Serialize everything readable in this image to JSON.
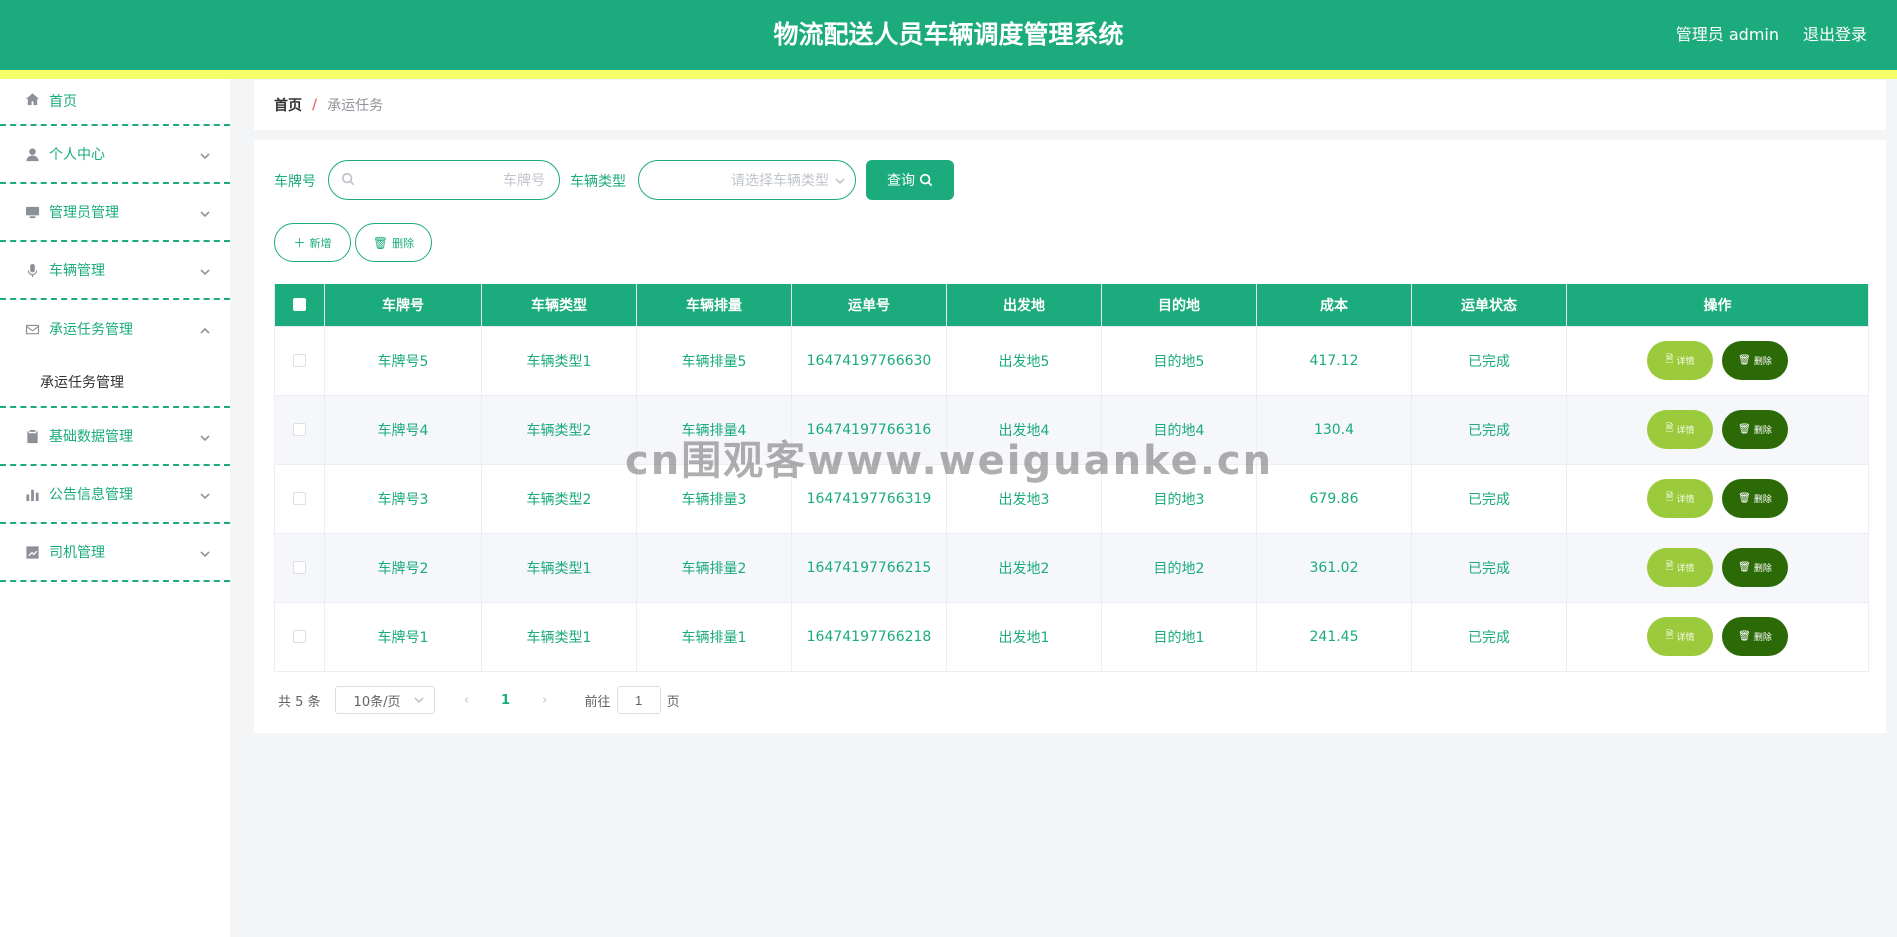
{
  "header": {
    "title": "物流配送人员车辆调度管理系统",
    "user": "管理员 admin",
    "logout": "退出登录"
  },
  "sidebar": {
    "items": [
      {
        "label": "首页",
        "icon": "home-icon"
      },
      {
        "label": "个人中心",
        "icon": "user-icon"
      },
      {
        "label": "管理员管理",
        "icon": "monitor-icon"
      },
      {
        "label": "车辆管理",
        "icon": "microphone-icon"
      },
      {
        "label": "承运任务管理",
        "icon": "mail-icon",
        "submenu": [
          "承运任务管理"
        ]
      },
      {
        "label": "基础数据管理",
        "icon": "clipboard-icon"
      },
      {
        "label": "公告信息管理",
        "icon": "bar-chart-icon"
      },
      {
        "label": "司机管理",
        "icon": "trend-chart-icon"
      }
    ]
  },
  "breadcrumb": {
    "home": "首页",
    "separator": "/",
    "current": "承运任务"
  },
  "search": {
    "plate_label": "车牌号",
    "plate_placeholder": "车牌号",
    "type_label": "车辆类型",
    "type_placeholder": "请选择车辆类型",
    "query_button": "查询"
  },
  "actions": {
    "add": "新增",
    "delete": "删除"
  },
  "table": {
    "columns": [
      "车牌号",
      "车辆类型",
      "车辆排量",
      "运单号",
      "出发地",
      "目的地",
      "成本",
      "运单状态",
      "操作"
    ],
    "rows": [
      {
        "plate": "车牌号5",
        "type": "车辆类型1",
        "displacement": "车辆排量5",
        "waybill": "16474197766630",
        "origin": "出发地5",
        "destination": "目的地5",
        "cost": "417.12",
        "status": "已完成"
      },
      {
        "plate": "车牌号4",
        "type": "车辆类型2",
        "displacement": "车辆排量4",
        "waybill": "16474197766316",
        "origin": "出发地4",
        "destination": "目的地4",
        "cost": "130.4",
        "status": "已完成"
      },
      {
        "plate": "车牌号3",
        "type": "车辆类型2",
        "displacement": "车辆排量3",
        "waybill": "16474197766319",
        "origin": "出发地3",
        "destination": "目的地3",
        "cost": "679.86",
        "status": "已完成"
      },
      {
        "plate": "车牌号2",
        "type": "车辆类型1",
        "displacement": "车辆排量2",
        "waybill": "16474197766215",
        "origin": "出发地2",
        "destination": "目的地2",
        "cost": "361.02",
        "status": "已完成"
      },
      {
        "plate": "车牌号1",
        "type": "车辆类型1",
        "displacement": "车辆排量1",
        "waybill": "16474197766218",
        "origin": "出发地1",
        "destination": "目的地1",
        "cost": "241.45",
        "status": "已完成"
      }
    ],
    "row_actions": {
      "detail": "详情",
      "delete": "删除"
    }
  },
  "pagination": {
    "total": "共 5 条",
    "page_size": "10条/页",
    "current_page": "1",
    "goto_prefix": "前往",
    "goto_value": "1",
    "goto_suffix": "页"
  },
  "watermark": "cn围观客www.weiguanke.cn",
  "colors": {
    "primary": "#1bab7d",
    "stripe": "#f4ff6a",
    "detail_button": "#9bcb3c",
    "delete_button": "#2c6a08"
  }
}
